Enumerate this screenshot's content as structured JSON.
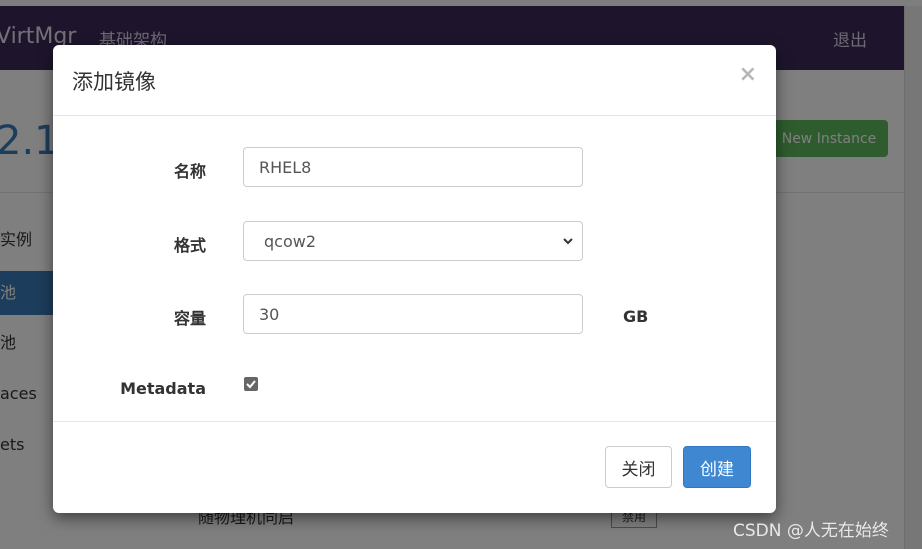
{
  "background": {
    "brand": "VirtMgr",
    "nav_link": "基础架构",
    "logout": "退出",
    "big_number": "2.1",
    "new_instance_button": "New Instance",
    "sidebar_items": [
      "实例",
      "池",
      "池",
      "aces",
      "ets"
    ],
    "row_text": "随物理机同启",
    "row_badge": "禁用"
  },
  "modal": {
    "title": "添加镜像",
    "close_symbol": "×",
    "fields": {
      "name": {
        "label": "名称",
        "value": "RHEL8"
      },
      "format": {
        "label": "格式",
        "selected": "qcow2"
      },
      "size": {
        "label": "容量",
        "value": "30",
        "unit": "GB"
      },
      "metadata": {
        "label": "Metadata",
        "checked": true
      }
    },
    "buttons": {
      "close": "关闭",
      "create": "创建"
    }
  },
  "watermark": "CSDN @人无在始终"
}
